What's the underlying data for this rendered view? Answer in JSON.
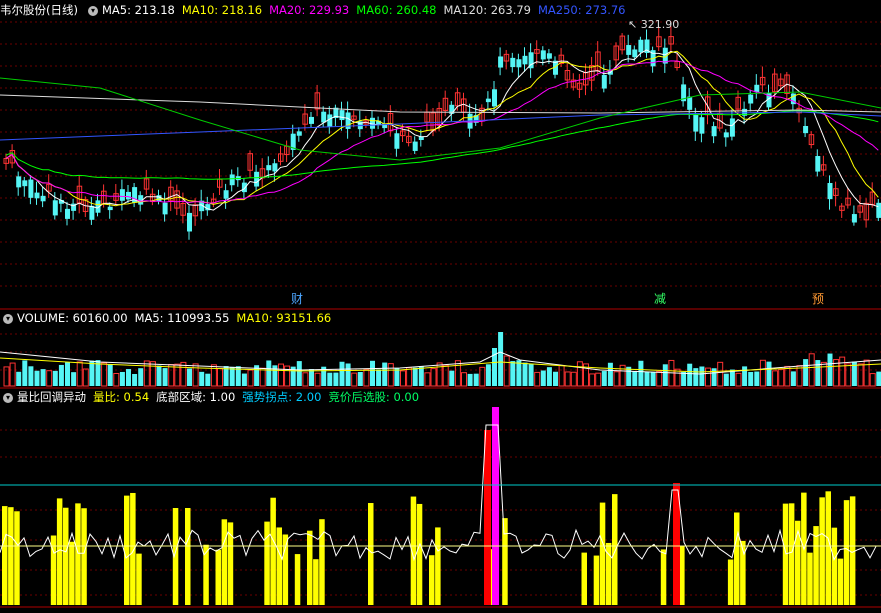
{
  "header_main": {
    "stock": "韦尔股份(日线)",
    "items": [
      {
        "text": "MA5: 213.18",
        "color": "#ffffff"
      },
      {
        "text": "MA10: 218.16",
        "color": "#ffff00"
      },
      {
        "text": "MA20: 229.93",
        "color": "#ff00ff"
      },
      {
        "text": "MA60: 260.48",
        "color": "#00ff00"
      },
      {
        "text": "MA120: 263.79",
        "color": "#dddddd"
      },
      {
        "text": "MA250: 273.76",
        "color": "#3355ff"
      }
    ]
  },
  "header_volume": {
    "label": "VOLUME: 60160.00",
    "items": [
      {
        "text": "MA5: 110993.55",
        "color": "#ffffff"
      },
      {
        "text": "MA10: 93151.66",
        "color": "#ffff00"
      }
    ]
  },
  "header_indicator": {
    "label": "量比回调异动",
    "items": [
      {
        "text": "量比: 0.54",
        "color": "#ffff00"
      },
      {
        "text": "底部区域: 1.00",
        "color": "#ffffff"
      },
      {
        "text": "强势拐点: 2.00",
        "color": "#00ccff"
      },
      {
        "text": "竞价后选股: 0.00",
        "color": "#00ff66"
      }
    ]
  },
  "peak_label": "321.90",
  "markers": [
    {
      "text": "财",
      "color": "#4da6ff"
    },
    {
      "text": "减",
      "color": "#33ff66"
    },
    {
      "text": "预",
      "color": "#ff9933"
    }
  ],
  "colors": {
    "up": "#ff3333",
    "down": "#55f5f5",
    "indicator_bar": "#ffff00",
    "indicator_red": "#ff0000",
    "indicator_magenta": "#ff00ff",
    "divider": "#b00000"
  }
}
